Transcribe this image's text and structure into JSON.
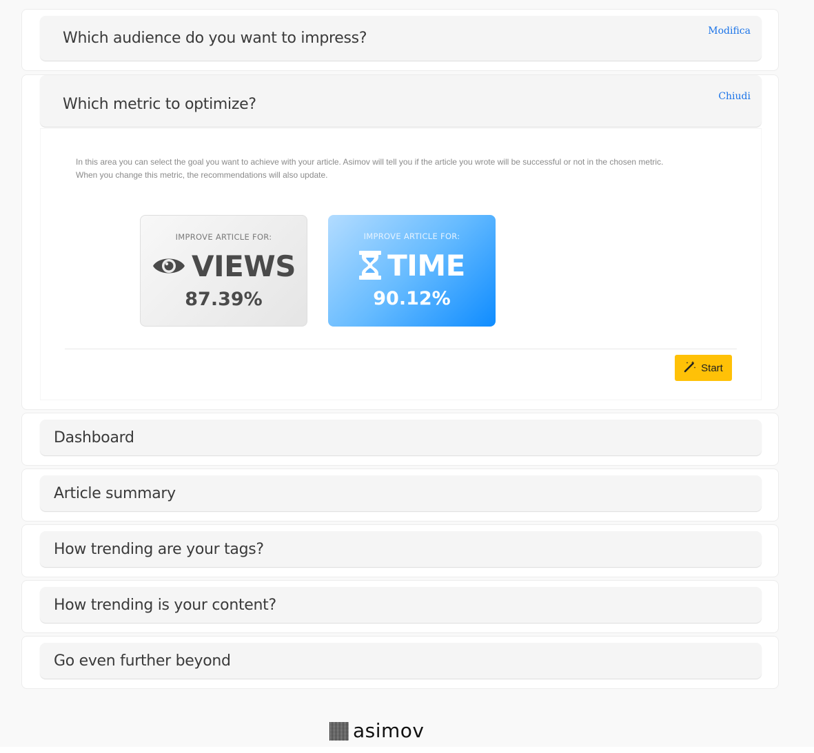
{
  "sections": {
    "audience": {
      "title": "Which audience do you want to impress?",
      "link": "Modifica"
    },
    "metric": {
      "title": "Which metric to optimize?",
      "link": "Chiudi",
      "description_line1": "In this area you can select the goal you want to achieve with your article. Asimov will tell you if the article you wrote will be successful or not in the chosen metric.",
      "description_line2": "When you change this metric, the recommendations will also update.",
      "cards": {
        "views": {
          "label": "IMPROVE ARTICLE FOR:",
          "name": "VIEWS",
          "value": "87.39%",
          "icon": "eye-icon"
        },
        "time": {
          "label": "IMPROVE ARTICLE FOR:",
          "name": "TIME",
          "value": "90.12%",
          "icon": "hourglass-icon",
          "selected": true
        }
      },
      "start_button": {
        "label": "Start",
        "icon": "magic-wand-icon"
      }
    },
    "dashboard": {
      "title": "Dashboard"
    },
    "article_summary": {
      "title": "Article summary"
    },
    "tags": {
      "title": "How trending are your tags?"
    },
    "content": {
      "title": "How trending is your content?"
    },
    "beyond": {
      "title": "Go even further beyond"
    }
  },
  "footer": {
    "logo_text": "asimov"
  },
  "colors": {
    "link": "#1a73e8",
    "start_button": "#ffc107",
    "time_card_start": "#b3dcff",
    "time_card_end": "#0f8cff",
    "header_bg": "#f5f5f5"
  }
}
